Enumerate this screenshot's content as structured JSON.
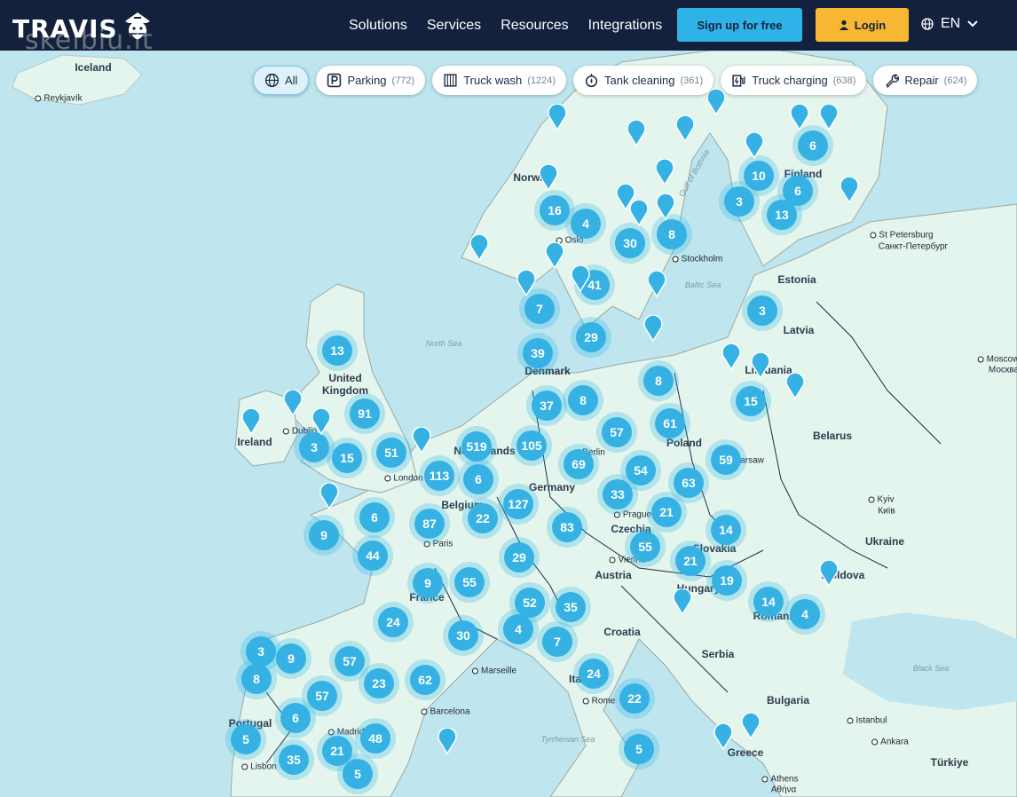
{
  "header": {
    "logo_text": "TRAVIS",
    "watermark": "skelbiu.lt",
    "nav": [
      "Solutions",
      "Services",
      "Resources",
      "Integrations"
    ],
    "signup_label": "Sign up for free",
    "login_label": "Login",
    "lang_label": "EN",
    "colors": {
      "bg": "#14213d",
      "signup": "#2fb2e8",
      "login": "#f7b733"
    }
  },
  "filters": [
    {
      "label": "All",
      "count": "",
      "icon": "globe-icon",
      "active": true
    },
    {
      "label": "Parking",
      "count": "(772)",
      "icon": "parking-icon",
      "active": false
    },
    {
      "label": "Truck wash",
      "count": "(1224)",
      "icon": "truck-wash-icon",
      "active": false
    },
    {
      "label": "Tank cleaning",
      "count": "(361)",
      "icon": "tank-cleaning-icon",
      "active": false
    },
    {
      "label": "Truck charging",
      "count": "(638)",
      "icon": "charging-icon",
      "active": false
    },
    {
      "label": "Repair",
      "count": "(624)",
      "icon": "wrench-icon",
      "active": false
    }
  ],
  "places": {
    "countries": [
      "Iceland",
      "Norway",
      "Finland",
      "Estonia",
      "Latvia",
      "Lithuania",
      "Belarus",
      "Ukraine",
      "Moldova",
      "Romania",
      "Hungary",
      "Slovakia",
      "Czechia",
      "Austria",
      "Germany",
      "Poland",
      "Denmark",
      "Netherlands",
      "Belgium",
      "France",
      "Ireland",
      "United Kingdom",
      "Portugal",
      "Croatia",
      "Serbia",
      "Bulgaria",
      "Greece",
      "Türkiye",
      "Italy"
    ],
    "cities": [
      "Reykjavík",
      "Oslo",
      "Stockholm",
      "St Petersburg",
      "Санкт-Петербург",
      "Moscow",
      "Москва",
      "Kyiv",
      "Київ",
      "London",
      "Dublin",
      "Paris",
      "Prague",
      "Vienna",
      "Warsaw",
      "Berlin",
      "Madrid",
      "Lisbon",
      "Barcelona",
      "Marseille",
      "Rome",
      "Istanbul",
      "Ankara",
      "Athens",
      "Αθήνα"
    ],
    "seas": [
      "North Sea",
      "Baltic Sea",
      "Gulf of Bothnia",
      "Black Sea",
      "Tyrrhenian Sea"
    ]
  },
  "clusters": [
    "6",
    "10",
    "6",
    "3",
    "13",
    "16",
    "4",
    "30",
    "8",
    "41",
    "7",
    "29",
    "39",
    "13",
    "8",
    "37",
    "8",
    "15",
    "3",
    "91",
    "3",
    "15",
    "51",
    "519",
    "105",
    "57",
    "61",
    "113",
    "6",
    "69",
    "54",
    "63",
    "59",
    "87",
    "22",
    "127",
    "33",
    "21",
    "6",
    "9",
    "44",
    "83",
    "55",
    "14",
    "29",
    "21",
    "19",
    "9",
    "55",
    "52",
    "35",
    "14",
    "4",
    "24",
    "30",
    "4",
    "7",
    "3",
    "9",
    "57",
    "8",
    "23",
    "62",
    "57",
    "24",
    "22",
    "6",
    "5",
    "48",
    "21",
    "35",
    "5",
    "5"
  ]
}
